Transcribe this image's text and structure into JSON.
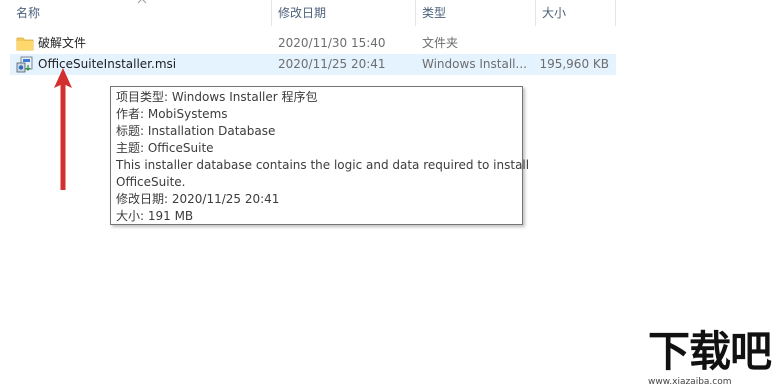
{
  "columns": {
    "name": "名称",
    "date": "修改日期",
    "type": "类型",
    "size": "大小"
  },
  "files": [
    {
      "name": "破解文件",
      "date": "2020/11/30 15:40",
      "type": "文件夹",
      "size": "",
      "icon": "folder-icon"
    },
    {
      "name": "OfficeSuiteInstaller.msi",
      "date": "2020/11/25 20:41",
      "type": "Windows Install...",
      "size": "195,960 KB",
      "icon": "msi-installer-icon",
      "selected": true
    }
  ],
  "tooltip": {
    "lines": [
      "项目类型: Windows Installer 程序包",
      "作者: MobiSystems",
      "标题: Installation Database",
      "主题: OfficeSuite",
      "This installer database contains the logic and data required to install",
      "OfficeSuite.",
      "修改日期: 2020/11/25 20:41",
      "大小: 191 MB"
    ]
  },
  "watermark": {
    "brand": "下载吧",
    "url": "www.xiazaiba.com"
  },
  "colors": {
    "selection": "#e5f3ff",
    "header_text": "#4c607a",
    "arrow": "#d32f2f",
    "folder": "#f3c95a"
  }
}
